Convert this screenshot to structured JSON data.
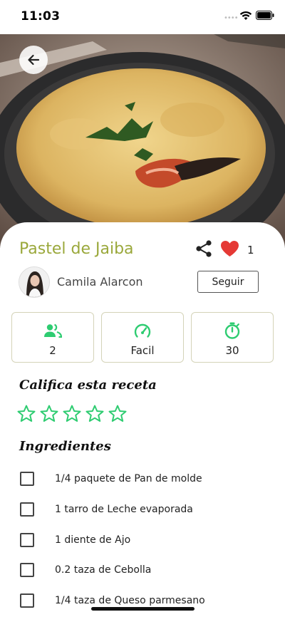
{
  "status_bar": {
    "time": "11:03",
    "dots": "••••"
  },
  "recipe": {
    "title": "Pastel de Jaiba",
    "likes": "1"
  },
  "author": {
    "name": "Camila Alarcon",
    "follow_label": "Seguir"
  },
  "info_cards": [
    {
      "icon": "people-icon",
      "value": "2"
    },
    {
      "icon": "speedometer-icon",
      "value": "Facil"
    },
    {
      "icon": "timer-icon",
      "value": "30"
    }
  ],
  "rating": {
    "title": "Califica esta receta",
    "stars_total": 5,
    "stars_filled": 0
  },
  "ingredients": {
    "title": "Ingredientes",
    "items": [
      "1/4 paquete de Pan de molde",
      "1 tarro de Leche evaporada",
      "1 diente de Ajo",
      "0.2 taza de Cebolla",
      "1/4 taza de Queso parmesano"
    ]
  },
  "colors": {
    "accent_title": "#9aa83b",
    "accent_icon": "#2ecc71",
    "heart": "#e53935"
  }
}
